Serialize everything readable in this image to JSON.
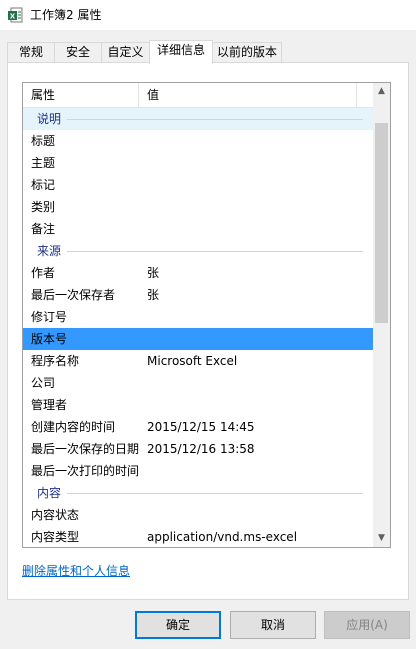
{
  "window": {
    "title": "工作簿2 属性",
    "icon": "excel-file-icon"
  },
  "tabs": [
    {
      "label": "常规"
    },
    {
      "label": "安全"
    },
    {
      "label": "自定义"
    },
    {
      "label": "详细信息",
      "active": true
    },
    {
      "label": "以前的版本"
    }
  ],
  "list": {
    "headers": {
      "property": "属性",
      "value": "值"
    },
    "rows": [
      {
        "type": "group",
        "name": "说明"
      },
      {
        "type": "item",
        "name": "标题",
        "value": ""
      },
      {
        "type": "item",
        "name": "主题",
        "value": ""
      },
      {
        "type": "item",
        "name": "标记",
        "value": ""
      },
      {
        "type": "item",
        "name": "类别",
        "value": ""
      },
      {
        "type": "item",
        "name": "备注",
        "value": ""
      },
      {
        "type": "group",
        "name": "来源"
      },
      {
        "type": "item",
        "name": "作者",
        "value": "张"
      },
      {
        "type": "item",
        "name": "最后一次保存者",
        "value": "张"
      },
      {
        "type": "item",
        "name": "修订号",
        "value": ""
      },
      {
        "type": "item",
        "name": "版本号",
        "value": "",
        "selected": true
      },
      {
        "type": "item",
        "name": "程序名称",
        "value": "Microsoft Excel"
      },
      {
        "type": "item",
        "name": "公司",
        "value": ""
      },
      {
        "type": "item",
        "name": "管理者",
        "value": ""
      },
      {
        "type": "item",
        "name": "创建内容的时间",
        "value": "2015/12/15 14:45"
      },
      {
        "type": "item",
        "name": "最后一次保存的日期",
        "value": "2015/12/16 13:58"
      },
      {
        "type": "item",
        "name": "最后一次打印的时间",
        "value": ""
      },
      {
        "type": "group",
        "name": "内容"
      },
      {
        "type": "item",
        "name": "内容状态",
        "value": ""
      },
      {
        "type": "item",
        "name": "内容类型",
        "value": "application/vnd.ms-excel"
      }
    ]
  },
  "link": {
    "label": "删除属性和个人信息"
  },
  "buttons": {
    "ok": "确定",
    "cancel": "取消",
    "apply": "应用(A)"
  },
  "colors": {
    "accent": "#0078d7",
    "selection": "#3399ff",
    "group_text": "#1e3287",
    "link": "#0066cc"
  }
}
